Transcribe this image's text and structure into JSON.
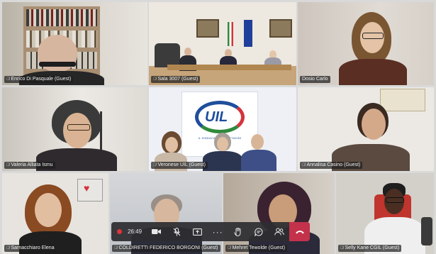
{
  "participants": [
    {
      "name": "Enrico Di Pasquale (Guest)",
      "muted": true
    },
    {
      "name": "Sala 3007 (Guest)",
      "muted": true
    },
    {
      "name": "Dosio Carlo",
      "muted": false
    },
    {
      "name": "Valeria Alliata Ismu",
      "muted": true
    },
    {
      "name": "Veronese UIL (Guest)",
      "muted": true
    },
    {
      "name": "Annalisa Casino (Guest)",
      "muted": true
    },
    {
      "name": "Sarnacchiaro Elena",
      "muted": true
    },
    {
      "name": "COLDIRETTI FEDERICO BORGONI (Guest)",
      "muted": true
    },
    {
      "name": "Mehret Tewolde (Guest)",
      "muted": true
    },
    {
      "name": "Selly Kane CGIL (Guest)",
      "muted": true
    }
  ],
  "banner": {
    "logo_text": "UIL",
    "logo_subtext": "IL SINDACATO DEI CITTADINI"
  },
  "controls": {
    "timer": "26:49",
    "icons": [
      "camera-icon",
      "mic-off-icon",
      "share-screen-icon",
      "more-icon",
      "raise-hand-icon",
      "chat-icon",
      "participants-icon",
      "hang-up-icon"
    ]
  },
  "colors": {
    "hangup": "#c4314b",
    "recording": "#e0343c",
    "uil_blue": "#1f4e9c"
  }
}
